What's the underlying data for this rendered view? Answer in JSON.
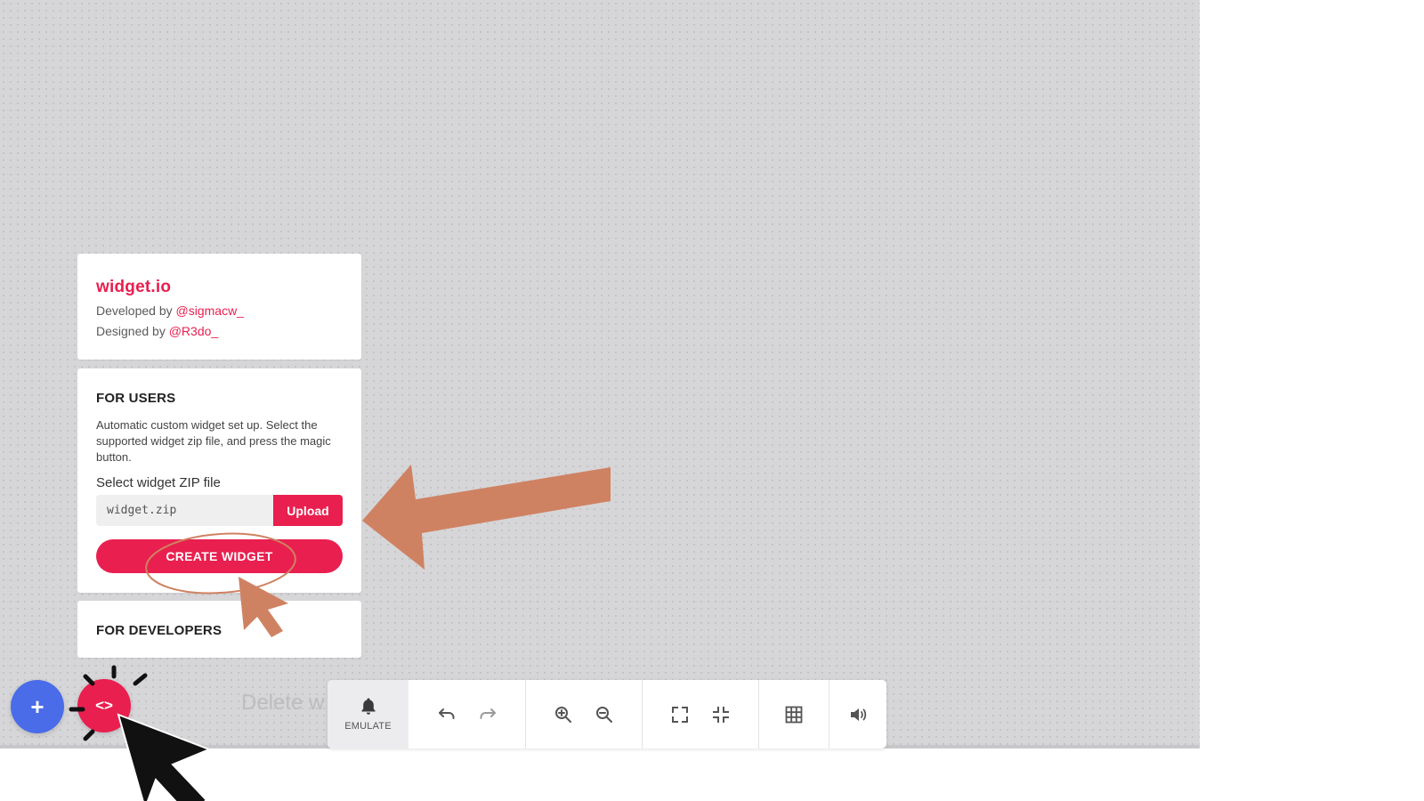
{
  "info": {
    "app_title": "widget.io",
    "developed_prefix": "Developed by",
    "developer": "@sigmacw_",
    "designed_prefix": "Designed by",
    "designer": "@R3do_"
  },
  "users": {
    "heading": "FOR USERS",
    "description": "Automatic custom widget set up. Select the supported widget zip file, and press the magic button.",
    "file_label": "Select widget ZIP file",
    "file_value": "widget.zip",
    "upload_label": "Upload",
    "create_label": "CREATE WIDGET"
  },
  "developers": {
    "heading": "FOR DEVELOPERS"
  },
  "fab": {
    "add_symbol": "+",
    "code_symbol": "<>"
  },
  "ghost_text": "Delete w",
  "toolbar": {
    "emulate_label": "EMULATE",
    "icons": [
      "bell-icon",
      "undo-icon",
      "redo-icon",
      "zoom-in-icon",
      "zoom-out-icon",
      "fullscreen-icon",
      "exit-fullscreen-icon",
      "grid-icon",
      "volume-icon"
    ]
  },
  "colors": {
    "accent": "#e91f4f",
    "fab_blue": "#4a6ce8",
    "canvas": "#d6d6d8",
    "annotation": "#cf8262"
  }
}
